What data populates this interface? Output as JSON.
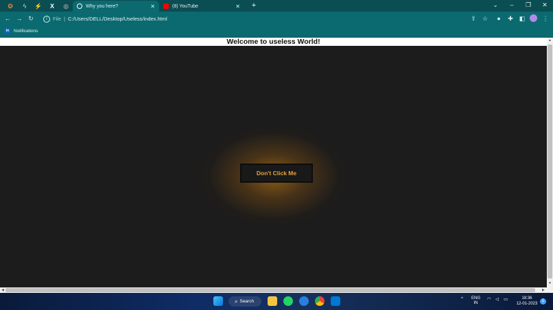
{
  "browser": {
    "tabs": [
      {
        "label": "Why you here?",
        "active": true
      },
      {
        "label": "(8) YouTube",
        "active": false
      }
    ],
    "new_tab_label": "+",
    "address": {
      "scheme_label": "File",
      "url": "C:/Users/DELL/Desktop/Useless/index.html"
    },
    "bookmarks": [
      {
        "label": "Notifications",
        "icon": "linkedin-icon",
        "icon_text": "in"
      }
    ]
  },
  "page": {
    "heading": "Welcome to useless World!",
    "button_label": "Don't Click Me",
    "colors": {
      "background": "#1c1c1c",
      "button_text": "#e8a23a",
      "glow": "#a06914"
    }
  },
  "taskbar": {
    "search_label": "Search",
    "language": "ENG",
    "region": "IN",
    "time": "18:36",
    "date": "12-01-2023"
  }
}
